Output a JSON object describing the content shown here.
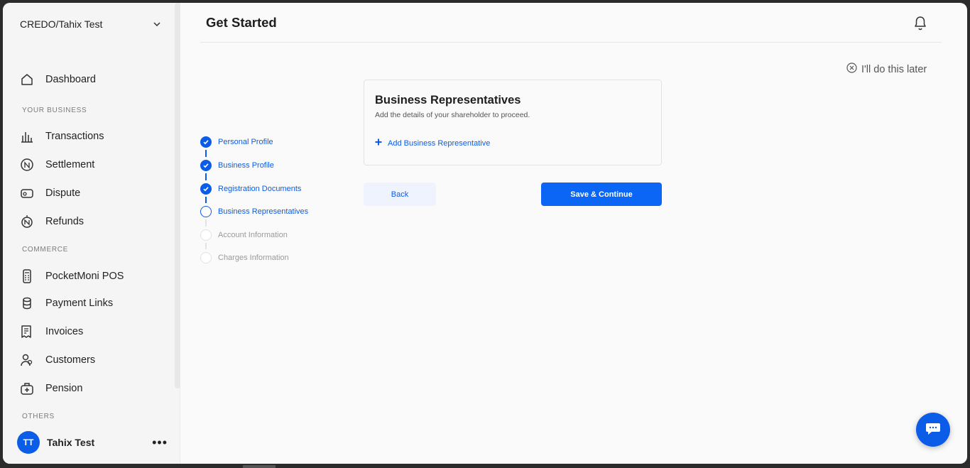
{
  "sidebar": {
    "org_name": "CREDO/Tahix Test",
    "dashboard": "Dashboard",
    "sections": {
      "your_business": "YOUR BUSINESS",
      "commerce": "COMMERCE",
      "others": "OTHERS"
    },
    "items": {
      "transactions": "Transactions",
      "settlement": "Settlement",
      "dispute": "Dispute",
      "refunds": "Refunds",
      "pos": "PocketMoni POS",
      "payment_links": "Payment Links",
      "invoices": "Invoices",
      "customers": "Customers",
      "pension": "Pension"
    },
    "user": {
      "initials": "TT",
      "name": "Tahix Test",
      "more": "•••"
    }
  },
  "header": {
    "title": "Get Started",
    "skip_label": "I'll do this later"
  },
  "stepper": {
    "steps": [
      {
        "label": "Personal Profile",
        "state": "done"
      },
      {
        "label": "Business Profile",
        "state": "done"
      },
      {
        "label": "Registration Documents",
        "state": "done"
      },
      {
        "label": "Business Representatives",
        "state": "current"
      },
      {
        "label": "Account Information",
        "state": "todo"
      },
      {
        "label": "Charges Information",
        "state": "todo"
      }
    ]
  },
  "card": {
    "title": "Business Representatives",
    "subtitle": "Add the details of your shareholder to proceed.",
    "add_label": "Add Business Representative"
  },
  "actions": {
    "back": "Back",
    "save": "Save & Continue"
  },
  "colors": {
    "primary": "#0b5ce6",
    "button_primary": "#0b66f5",
    "back_bg": "#eef3fd",
    "inactive": "#9a9a9a"
  }
}
